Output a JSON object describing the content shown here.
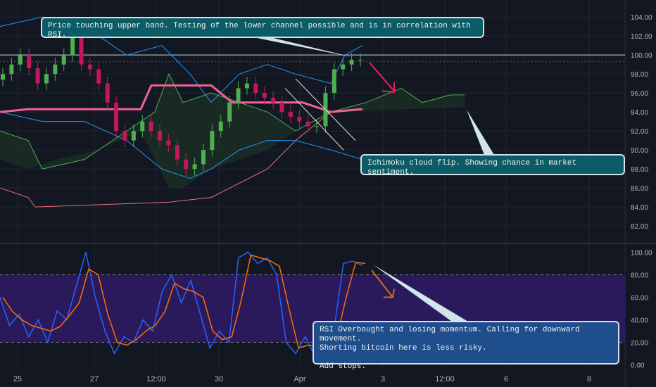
{
  "chart_data": [
    {
      "type": "candlestick",
      "panel": "price",
      "ylim": [
        80.6,
        105.2
      ],
      "y_ticks": [
        "104.00",
        "102.00",
        "100.00",
        "98.00",
        "96.00",
        "94.00",
        "92.00",
        "90.00",
        "88.00",
        "86.00",
        "84.00",
        "82.00"
      ],
      "y_tick_values": [
        104,
        102,
        100,
        98,
        96,
        94,
        92,
        90,
        88,
        86,
        84,
        82
      ],
      "horizontal_line": 100.0,
      "dotted_line": 99.3,
      "grid": true,
      "colors": {
        "up": "#4caf50",
        "down": "#c2185b",
        "bb": "#2196f3",
        "cloud": "#2e7d32",
        "baseline": "#f06292",
        "arrow_pink": "#e91e63"
      },
      "series": [
        {
          "kind": "close",
          "values": [
            98,
            99,
            100,
            98.6,
            97,
            98,
            99,
            100,
            102,
            99,
            98.5,
            97,
            95,
            92,
            91,
            92,
            93,
            92,
            91,
            90.5,
            89,
            88,
            88.5,
            90,
            92,
            93,
            95,
            96.5,
            97,
            96,
            95.5,
            95,
            94,
            93.5,
            93,
            92.5,
            92.5,
            96,
            98.5,
            99,
            99.5,
            99.5
          ]
        }
      ]
    },
    {
      "type": "line",
      "panel": "rsi",
      "ylim": [
        -4,
        104
      ],
      "y_ticks": [
        "100.00",
        "80.00",
        "60.00",
        "40.00",
        "20.00",
        "0.00"
      ],
      "y_tick_values": [
        100,
        80,
        60,
        40,
        20,
        0
      ],
      "overbought": 80,
      "oversold": 20,
      "colors": {
        "k": "#2962ff",
        "d": "#ff6d00",
        "band": "#311b6b"
      },
      "series": [
        {
          "name": "",
          "values": [
            60,
            35,
            45,
            25,
            40,
            20,
            48,
            40,
            70,
            100,
            60,
            30,
            10,
            25,
            20,
            40,
            30,
            65,
            80,
            55,
            75,
            45,
            15,
            30,
            20,
            95,
            100,
            90,
            95,
            80,
            20,
            10,
            25,
            8,
            18,
            30,
            90,
            92,
            88
          ]
        }
      ]
    }
  ],
  "x_axis": {
    "labels": [
      "25",
      "27",
      "12:00",
      "30",
      "Apr",
      "3",
      "12:00",
      "6",
      "8"
    ]
  },
  "annotations": {
    "top": "Price touching upper band. Testing of the lower channel possible and is in correlation with RSI.",
    "ichimoku": "Ichimoku cloud flip. Showing chance in market sentiment.",
    "rsi": "RSI Overbought and losing momentum. Calling for downward movement.\nShorting bitcoin here is less risky.\n\nAdd stops."
  }
}
